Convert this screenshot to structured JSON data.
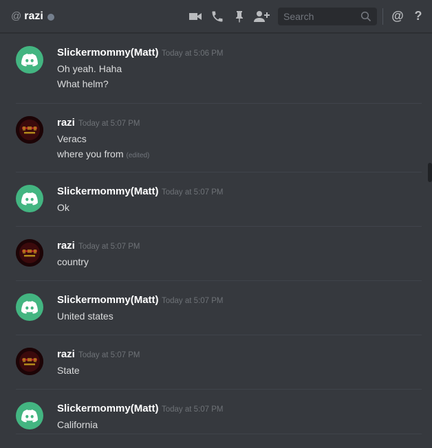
{
  "header": {
    "at_symbol": "@",
    "channel_name": "razi",
    "search_placeholder": "Search",
    "help_label": "?",
    "mention_label": "@"
  },
  "messages": [
    {
      "author": "Slickermommy(Matt)",
      "avatar": "discord-logo-icon",
      "timestamp": "Today at 5:06 PM",
      "lines": [
        {
          "text": "Oh yeah. Haha"
        },
        {
          "text": "What helm?"
        }
      ]
    },
    {
      "author": "razi",
      "avatar": "razi-avatar",
      "timestamp": "Today at 5:07 PM",
      "lines": [
        {
          "text": "Veracs"
        },
        {
          "text": "where you from",
          "edited": "(edited)"
        }
      ]
    },
    {
      "author": "Slickermommy(Matt)",
      "avatar": "discord-logo-icon",
      "timestamp": "Today at 5:07 PM",
      "lines": [
        {
          "text": "Ok"
        }
      ]
    },
    {
      "author": "razi",
      "avatar": "razi-avatar",
      "timestamp": "Today at 5:07 PM",
      "lines": [
        {
          "text": "country"
        }
      ]
    },
    {
      "author": "Slickermommy(Matt)",
      "avatar": "discord-logo-icon",
      "timestamp": "Today at 5:07 PM",
      "lines": [
        {
          "text": "United states"
        }
      ]
    },
    {
      "author": "razi",
      "avatar": "razi-avatar",
      "timestamp": "Today at 5:07 PM",
      "lines": [
        {
          "text": "State"
        }
      ]
    },
    {
      "author": "Slickermommy(Matt)",
      "avatar": "discord-logo-icon",
      "timestamp": "Today at 5:07 PM",
      "lines": [
        {
          "text": "California"
        }
      ]
    }
  ],
  "colors": {
    "background": "#36393e",
    "discord_green": "#43b581",
    "username": "#ffffff",
    "message_text": "#dcddde",
    "timestamp": "#6e7277",
    "offline_status": "#747f8d"
  },
  "icons": [
    "video-call-icon",
    "voice-call-icon",
    "pin-icon",
    "add-friend-icon",
    "search-icon",
    "mention-icon",
    "help-icon"
  ]
}
